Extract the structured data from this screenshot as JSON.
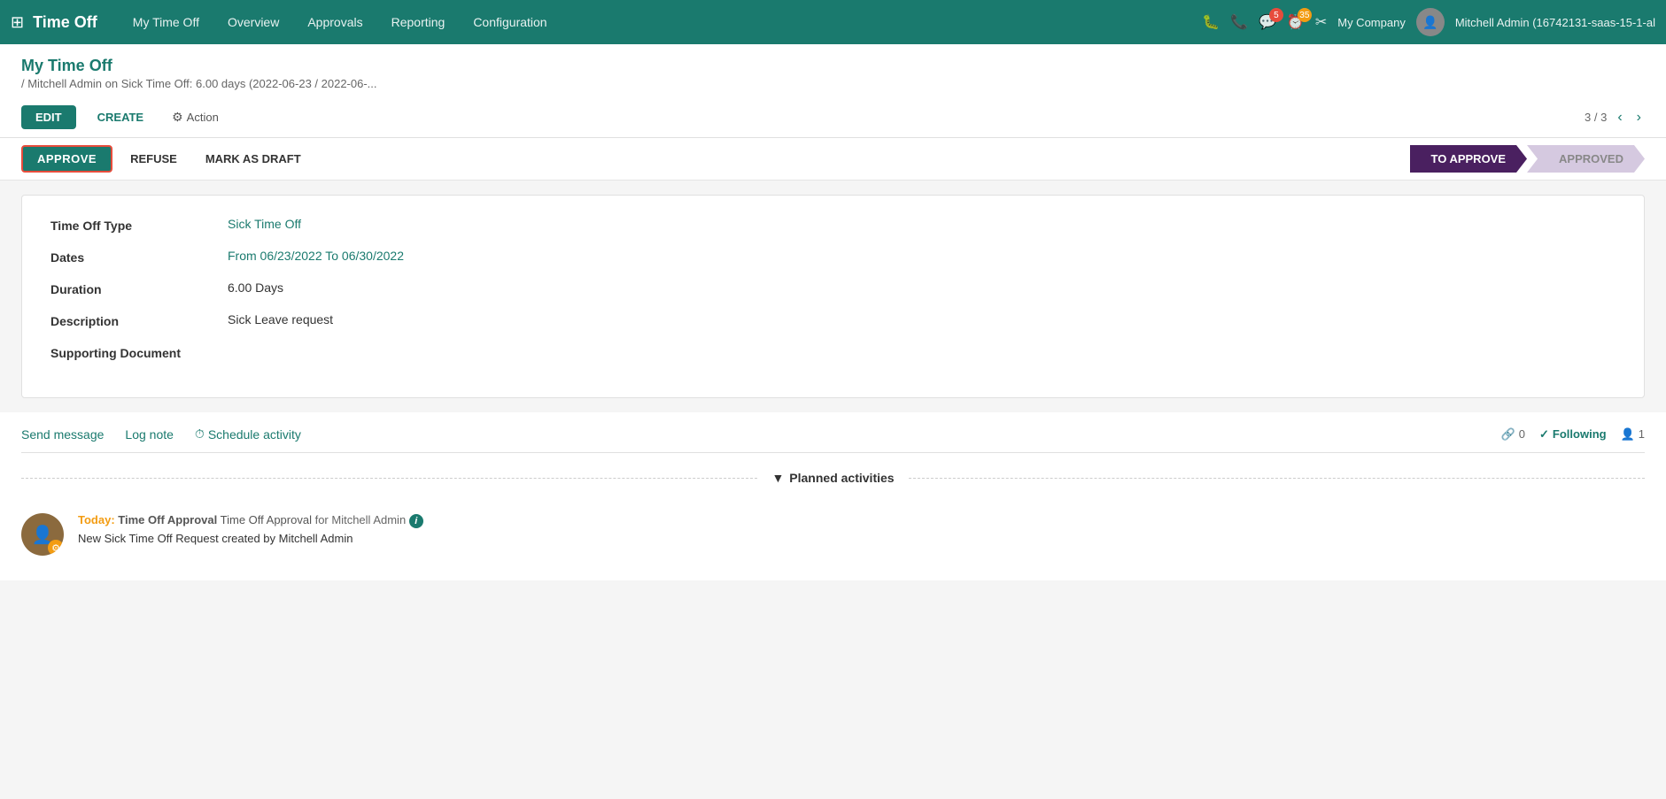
{
  "topnav": {
    "app_title": "Time Off",
    "menu_items": [
      {
        "label": "My Time Off",
        "id": "my-time-off"
      },
      {
        "label": "Overview",
        "id": "overview"
      },
      {
        "label": "Approvals",
        "id": "approvals"
      },
      {
        "label": "Reporting",
        "id": "reporting"
      },
      {
        "label": "Configuration",
        "id": "configuration"
      }
    ],
    "notifications_count": "5",
    "clock_count": "35",
    "company": "My Company",
    "user": "Mitchell Admin (16742131-saas-15-1-al"
  },
  "breadcrumb": {
    "parent": "My Time Off",
    "current": "/ Mitchell Admin on Sick Time Off: 6.00 days (2022-06-23 / 2022-06-..."
  },
  "toolbar": {
    "edit_label": "EDIT",
    "create_label": "CREATE",
    "action_label": "Action",
    "pagination": "3 / 3"
  },
  "status_bar": {
    "approve_label": "APPROVE",
    "refuse_label": "REFUSE",
    "mark_draft_label": "MARK AS DRAFT",
    "steps": [
      {
        "label": "TO APPROVE",
        "active": true
      },
      {
        "label": "APPROVED",
        "active": false
      }
    ]
  },
  "form": {
    "fields": [
      {
        "label": "Time Off Type",
        "value": "Sick Time Off",
        "colored": true
      },
      {
        "label": "Dates",
        "value": "From  06/23/2022  To  06/30/2022",
        "colored": true
      },
      {
        "label": "Duration",
        "value": "6.00 Days",
        "colored": false
      },
      {
        "label": "Description",
        "value": "Sick Leave request",
        "colored": false
      },
      {
        "label": "Supporting Document",
        "value": "",
        "colored": false
      }
    ]
  },
  "chatter": {
    "send_message_label": "Send message",
    "log_note_label": "Log note",
    "schedule_activity_label": "Schedule activity",
    "links_count": "0",
    "following_label": "Following",
    "followers_count": "1",
    "planned_activities_label": "Planned activities"
  },
  "activity": {
    "date_label": "Today:",
    "title": "Time Off Approval",
    "for_label": "for Mitchell Admin",
    "description": "New Sick Time Off Request created by Mitchell Admin"
  }
}
